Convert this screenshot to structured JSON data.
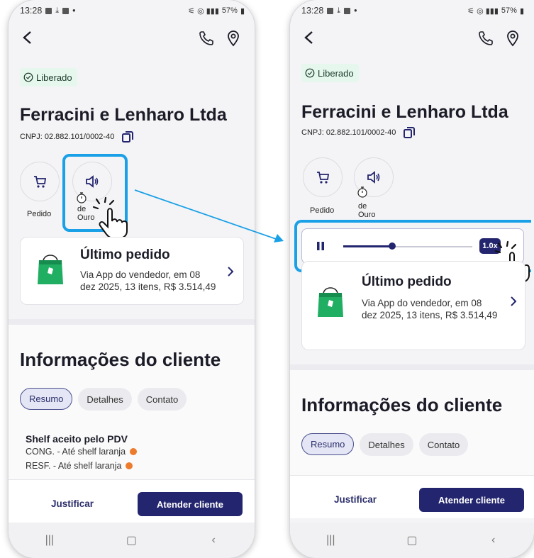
{
  "status": {
    "time": "13:28",
    "battery": "57%"
  },
  "chip_liberado": "Liberado",
  "company_name": "Ferracini e Lenharo Ltda",
  "cnpj": "CNPJ: 02.882.101/0002-40",
  "actions": {
    "pedido_label": "Pedido",
    "audio_label_line1": "de",
    "audio_label_line2": "Ouro"
  },
  "last_order": {
    "title": "Último pedido",
    "desc_line1": "Via App do vendedor, em 08",
    "desc_line2": "dez 2025, 13 itens, R$ 3.514,49"
  },
  "info_title": "Informações do cliente",
  "tabs": [
    {
      "label": "Resumo",
      "active": true
    },
    {
      "label": "Detalhes",
      "active": false
    },
    {
      "label": "Contato",
      "active": false
    }
  ],
  "shelf": {
    "title": "Shelf aceito pelo PDV",
    "lines": [
      "CONG. - Até shelf laranja",
      "RESF. - Até shelf laranja"
    ]
  },
  "bottom": {
    "justificar": "Justificar",
    "atender": "Atender cliente"
  },
  "player": {
    "speed": "1.0x",
    "progress": 0.38
  },
  "colors": {
    "accent": "#23256e",
    "highlight": "#1aa0e6",
    "status_dot": "#ec7c2c",
    "chip_bg": "#e6f7ee"
  },
  "icons": [
    "back-icon",
    "phone-icon",
    "location-pin-icon",
    "check-circle-icon",
    "copy-icon",
    "cart-icon",
    "speaker-icon",
    "timer-icon",
    "shopping-bag-icon",
    "chevron-right-icon",
    "pause-icon",
    "hand-pointer-icon"
  ]
}
